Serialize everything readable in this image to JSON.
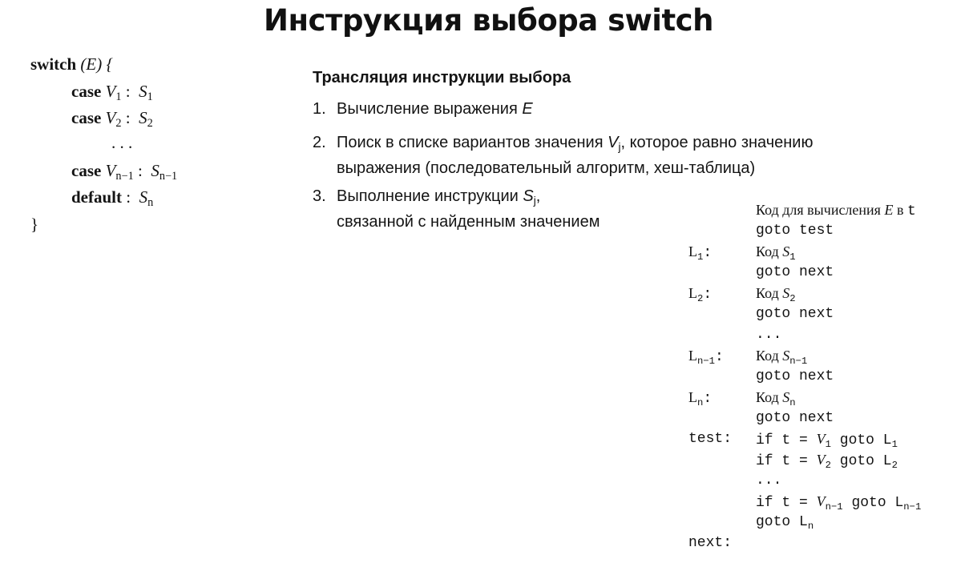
{
  "title": "Инструкция выбора switch",
  "syntax": {
    "switch_kw": "switch",
    "switch_expr": "(E) {",
    "case_kw": "case",
    "v1": "V",
    "v1_sub": "1",
    "s1": "S",
    "s1_sub": "1",
    "v2": "V",
    "v2_sub": "2",
    "s2": "S",
    "s2_sub": "2",
    "dots": ". . .",
    "vn1": "V",
    "vn1_sub": "n−1",
    "sn1": "S",
    "sn1_sub": "n−1",
    "default_kw": "default",
    "sn": "S",
    "sn_sub": "n",
    "colon": ":",
    "close_brace": "}"
  },
  "translation": {
    "heading": "Трансляция инструкции выбора",
    "steps": [
      {
        "num": "1.",
        "text": "Вычисление выражения ",
        "var": "E"
      },
      {
        "num": "2.",
        "text": "Поиск в списке вариантов значения ",
        "var": "V",
        "var_sub": "j",
        "text2": ", которое равно значению",
        "line2": "выражения (последовательный алгоритм, хеш-таблица)"
      },
      {
        "num": "3.",
        "text": "Выполнение инструкции ",
        "var": "S",
        "var_sub": "j",
        "text2": ",",
        "line2": "связанной с найденным значением"
      }
    ]
  },
  "code": {
    "line1_a": "Код для вычисления ",
    "line1_var": "E",
    "line1_b": " в ",
    "line1_t": "t",
    "goto_test": "goto test",
    "l1_label": "L",
    "l1_sub": "1",
    "label_colon": ":",
    "kod": "Код ",
    "s": "S",
    "s1_sub": "1",
    "goto_next": "goto next",
    "l2_label": "L",
    "l2_sub": "2",
    "s2_sub": "2",
    "dots": "...",
    "ln1_label": "L",
    "ln1_sub": "n−1",
    "sn1_sub": "n−1",
    "ln_label": "L",
    "ln_sub": "n",
    "sn_sub": "n",
    "test_label": "test:",
    "if_prefix": "if t = ",
    "v": "V",
    "goto_mid": " goto L",
    "v1_sub": "1",
    "gl1_sub": "1",
    "v2_sub": "2",
    "gl2_sub": "2",
    "vn1_sub": "n−1",
    "gln1_sub": "n−1",
    "goto_l": "goto L",
    "gln_sub": "n",
    "next_label": "next:"
  }
}
